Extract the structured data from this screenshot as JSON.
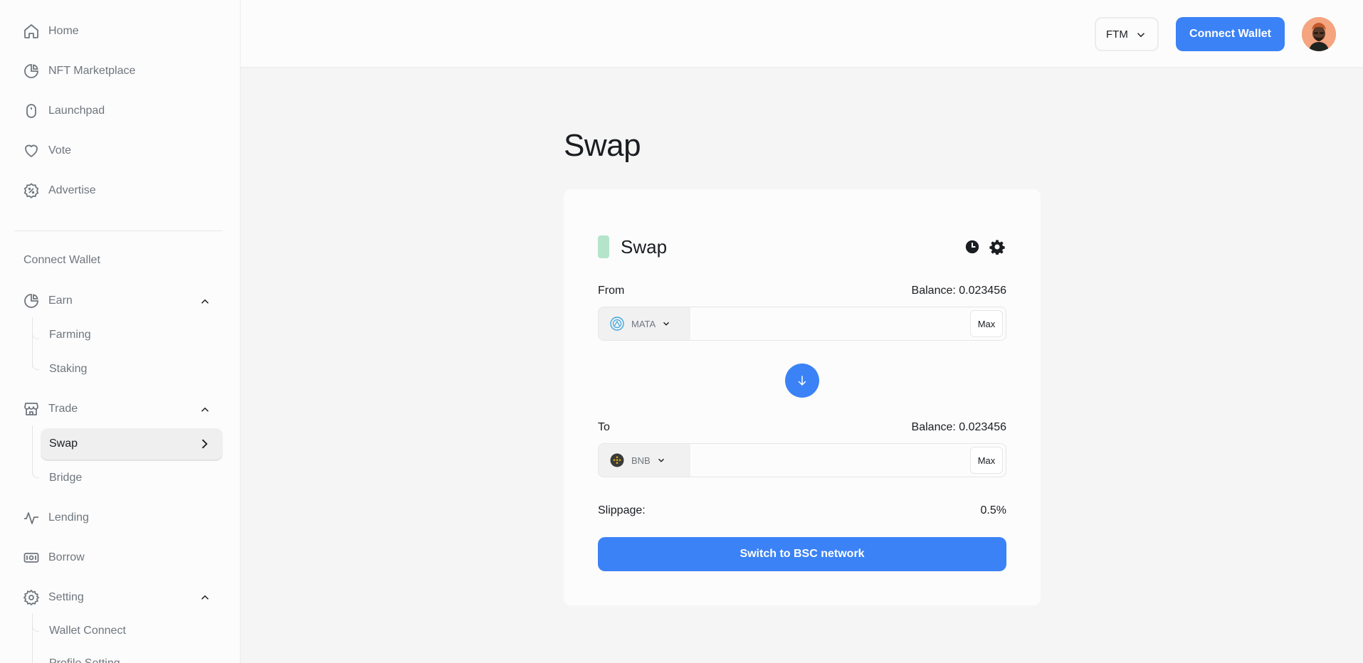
{
  "sidebar": {
    "items": [
      {
        "label": "Home",
        "icon": "home-icon"
      },
      {
        "label": "NFT Marketplace",
        "icon": "pie-chart-icon"
      },
      {
        "label": "Launchpad",
        "icon": "mouse-icon"
      },
      {
        "label": "Vote",
        "icon": "heart-icon"
      },
      {
        "label": "Advertise",
        "icon": "discount-badge-icon"
      }
    ],
    "section_label": "Connect Wallet",
    "groups": {
      "earn": {
        "label": "Earn",
        "icon": "pie-chart-icon",
        "children": [
          "Farming",
          "Staking"
        ]
      },
      "trade": {
        "label": "Trade",
        "icon": "store-icon",
        "children": [
          "Swap",
          "Bridge"
        ],
        "active": "Swap"
      },
      "lending": {
        "label": "Lending",
        "icon": "activity-icon"
      },
      "borrow": {
        "label": "Borrow",
        "icon": "ticket-icon"
      },
      "setting": {
        "label": "Setting",
        "icon": "gear-icon",
        "children": [
          "Wallet Connect",
          "Profile Setting"
        ]
      }
    }
  },
  "header": {
    "network": "FTM",
    "connect_label": "Connect Wallet"
  },
  "main": {
    "title": "Swap",
    "card": {
      "title": "Swap",
      "from_label": "From",
      "from_balance": "Balance: 0.023456",
      "from_token": "MATA",
      "to_label": "To",
      "to_balance": "Balance: 0.023456",
      "to_token": "BNB",
      "max_label": "Max",
      "slippage_label": "Slippage:",
      "slippage_value": "0.5%",
      "action_label": "Switch to BSC network"
    }
  },
  "colors": {
    "accent": "#3b82f6",
    "tag": "#b5e4ca",
    "text": "#1a1d21",
    "muted": "#6f767e"
  }
}
